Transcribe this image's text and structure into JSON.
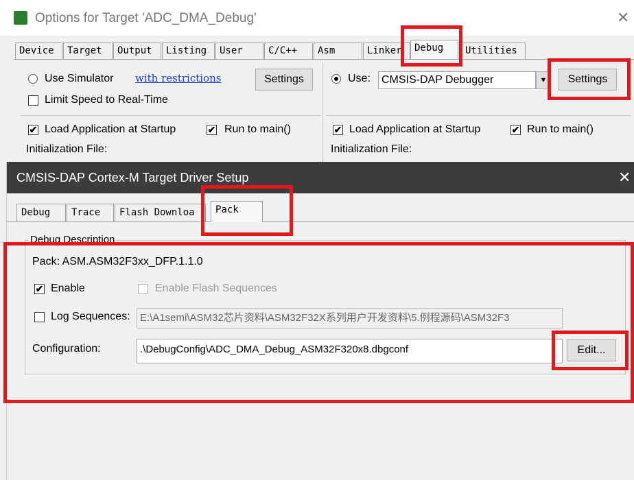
{
  "outer_window": {
    "title": "Options for Target 'ADC_DMA_Debug'",
    "close_glyph": "✕",
    "tabs": [
      "Device",
      "Target",
      "Output",
      "Listing",
      "User",
      "C/C++",
      "Asm",
      "Linker",
      "Debug",
      "Utilities"
    ],
    "active_tab": "Debug",
    "left": {
      "use_simulator_label": "Use Simulator",
      "restrictions_link": "with restrictions",
      "settings_label": "Settings",
      "limit_speed_label": "Limit Speed to Real-Time",
      "load_app_label": "Load Application at Startup",
      "run_to_main_label": "Run to main()",
      "init_file_label": "Initialization File:"
    },
    "right": {
      "use_label": "Use:",
      "debugger_value": "CMSIS-DAP Debugger",
      "settings_label": "Settings",
      "load_app_label": "Load Application at Startup",
      "run_to_main_label": "Run to main()",
      "init_file_label": "Initialization File:"
    }
  },
  "inner_dialog": {
    "title": "CMSIS-DAP Cortex-M Target Driver Setup",
    "close_glyph": "✕",
    "tabs": [
      "Debug",
      "Trace",
      "Flash Downloa",
      "Pack"
    ],
    "active_tab": "Pack",
    "group_title": "Debug Description",
    "pack_text": "Pack: ASM.ASM32F3xx_DFP.1.1.0",
    "enable_label": "Enable",
    "enable_flash_label": "Enable Flash Sequences",
    "log_sequences_label": "Log Sequences:",
    "log_path": "E:\\A1semi\\ASM32芯片资料\\ASM32F32X系列用户开发资料\\5.例程源码\\ASM32F3",
    "configuration_label": "Configuration:",
    "configuration_value": ".\\DebugConfig\\ADC_DMA_Debug_ASM32F320x8.dbgconf",
    "edit_label": "Edit..."
  },
  "checkmark": "✔",
  "dropdown_arrow": "▼",
  "colors": {
    "highlight_red": "#e0181f",
    "inner_titlebar": "#3c3c3c",
    "link_blue": "#1a3fd1"
  }
}
